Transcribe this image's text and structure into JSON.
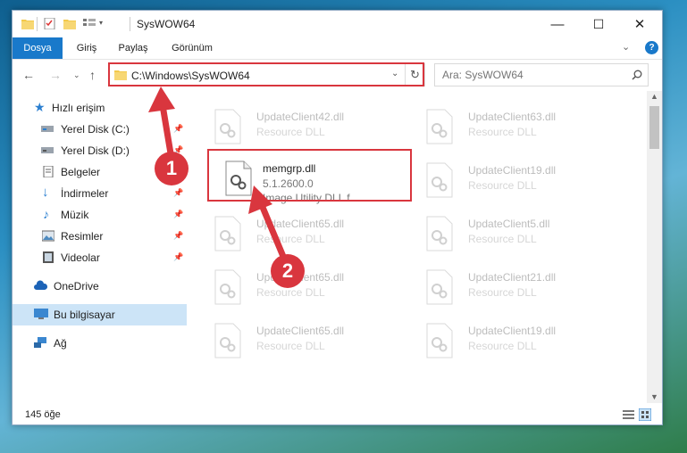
{
  "window": {
    "title": "SysWOW64",
    "controls": {
      "minimize": "—",
      "maximize": "☐",
      "close": "✕"
    }
  },
  "ribbon": {
    "tabs": [
      {
        "label": "Dosya",
        "active": true
      },
      {
        "label": "Giriş"
      },
      {
        "label": "Paylaş"
      },
      {
        "label": "Görünüm"
      }
    ],
    "expand_icon": "chevron-down-icon",
    "help_icon": "help-icon"
  },
  "address": {
    "path": "C:\\Windows\\SysWOW64",
    "search_placeholder": "Ara: SysWOW64"
  },
  "sidebar": {
    "items": [
      {
        "label": "Hızlı erişim",
        "icon": "star-icon",
        "pinned": false
      },
      {
        "label": "Yerel Disk (C:)",
        "icon": "drive-icon",
        "pinned": true
      },
      {
        "label": "Yerel Disk (D:)",
        "icon": "drive-icon",
        "pinned": true
      },
      {
        "label": "Belgeler",
        "icon": "document-icon",
        "pinned": true
      },
      {
        "label": "İndirmeler",
        "icon": "download-icon",
        "pinned": true
      },
      {
        "label": "Müzik",
        "icon": "music-icon",
        "pinned": true
      },
      {
        "label": "Resimler",
        "icon": "picture-icon",
        "pinned": true
      },
      {
        "label": "Videolar",
        "icon": "video-icon",
        "pinned": true
      },
      {
        "label": "OneDrive",
        "icon": "cloud-icon",
        "pinned": false
      },
      {
        "label": "Bu bilgisayar",
        "icon": "computer-icon",
        "pinned": false,
        "selected": true
      },
      {
        "label": "Ağ",
        "icon": "network-icon",
        "pinned": false
      }
    ]
  },
  "files": [
    {
      "name": "UpdateClient42.dll",
      "desc": "Resource DLL",
      "faded": true
    },
    {
      "name": "UpdateClient63.dll",
      "desc": "Resource DLL",
      "faded": true
    },
    {
      "name": "memgrp.dll",
      "desc": "5.1.2600.0",
      "desc2": "Image Utility DLL f...",
      "faded": false,
      "highlighted": true
    },
    {
      "name": "UpdateClient19.dll",
      "desc": "Resource DLL",
      "faded": true
    },
    {
      "name": "UpdateClient65.dll",
      "desc": "Resource DLL",
      "faded": true
    },
    {
      "name": "UpdateClient5.dll",
      "desc": "Resource DLL",
      "faded": true
    },
    {
      "name": "UpdateClient65.dll",
      "desc": "Resource DLL",
      "faded": true
    },
    {
      "name": "UpdateClient21.dll",
      "desc": "Resource DLL",
      "faded": true
    },
    {
      "name": "UpdateClient65.dll",
      "desc": "Resource DLL",
      "faded": true
    },
    {
      "name": "UpdateClient19.dll",
      "desc": "Resource DLL",
      "faded": true
    }
  ],
  "status": {
    "item_count": "145 öğe"
  },
  "annotations": {
    "badge1": "1",
    "badge2": "2",
    "color": "#d9363e"
  }
}
